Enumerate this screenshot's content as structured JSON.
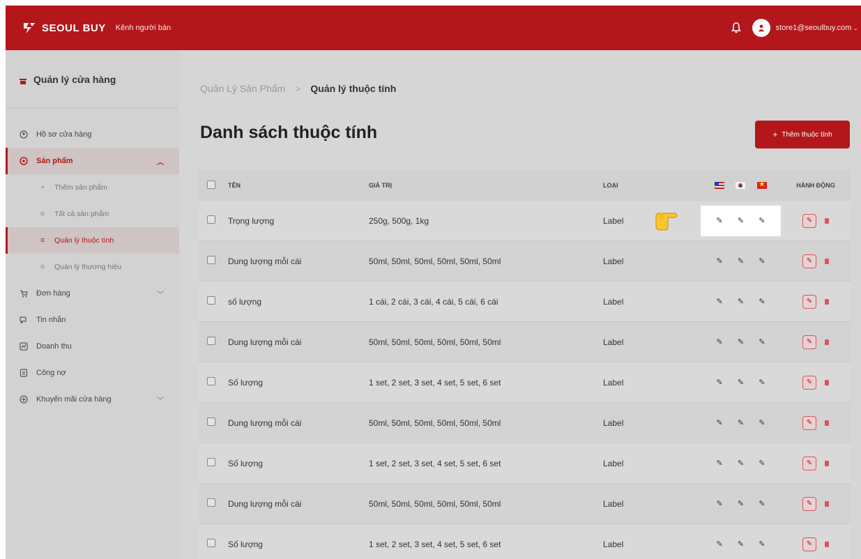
{
  "topbar": {
    "brand": "SEOUL BUY",
    "channel": "Kênh người bán",
    "user_email": "store1@seoulbuy.com",
    "colors": {
      "brand_red": "#b3171b"
    }
  },
  "sidebar": {
    "store_title": "Quản lý cửa hàng",
    "items": [
      {
        "label": "Hồ sơ cửa hàng",
        "icon": "store-profile-icon"
      },
      {
        "label": "Sản phẩm",
        "icon": "product-icon",
        "active": true,
        "expanded": true
      },
      {
        "label": "Đơn hàng",
        "icon": "cart-icon"
      },
      {
        "label": "Tin nhắn",
        "icon": "message-icon"
      },
      {
        "label": "Doanh thu",
        "icon": "revenue-icon"
      },
      {
        "label": "Công nợ",
        "icon": "debt-icon"
      },
      {
        "label": "Khuyến mãi cửa hàng",
        "icon": "promotion-icon"
      }
    ],
    "sub_items": [
      {
        "label": "Thêm sản phẩm",
        "icon": "plus-icon"
      },
      {
        "label": "Tất cả sản phẩm",
        "icon": "list-icon"
      },
      {
        "label": "Quản lý thuộc tính",
        "icon": "list-icon",
        "active": true
      },
      {
        "label": "Quản lý thương hiệu",
        "icon": "list-icon"
      }
    ]
  },
  "main": {
    "breadcrumb": {
      "parent": "Quản Lý Sản Phẩm",
      "separator": ">",
      "current": "Quản lý thuộc tính"
    },
    "title": "Danh sách thuộc tính",
    "add_button": "Thêm thuộc tính",
    "table": {
      "headers": {
        "name": "TÊN",
        "value": "GIÁ TRỊ",
        "type": "LOẠI",
        "actions": "HÀNH ĐỘNG"
      },
      "flags": [
        "us-flag-icon",
        "kr-flag-icon",
        "vn-flag-icon"
      ],
      "rows": [
        {
          "name": "Trọng lượng",
          "value": "250g, 500g, 1kg",
          "type": "Label"
        },
        {
          "name": "Dung lượng mỗi cái",
          "value": "50ml, 50ml, 50ml, 50ml, 50ml, 50ml",
          "type": "Label"
        },
        {
          "name": "số lượng",
          "value": "1 cái, 2 cái, 3 cái, 4 cái, 5 cái, 6 cái",
          "type": "Label"
        },
        {
          "name": "Dung lượng mỗi cái",
          "value": "50ml, 50ml, 50ml, 50ml, 50ml, 50ml",
          "type": "Label"
        },
        {
          "name": "Số lượng",
          "value": "1 set, 2 set, 3 set, 4 set, 5 set, 6 set",
          "type": "Label"
        },
        {
          "name": "Dung lượng mỗi cái",
          "value": "50ml, 50ml, 50ml, 50ml, 50ml, 50ml",
          "type": "Label"
        },
        {
          "name": "Số lượng",
          "value": "1 set, 2 set, 3 set, 4 set, 5 set, 6 set",
          "type": "Label"
        },
        {
          "name": "Dung lượng mỗi cái",
          "value": "50ml, 50ml, 50ml, 50ml, 50ml, 50ml",
          "type": "Label"
        },
        {
          "name": "Số lượng",
          "value": "1 set, 2 set, 3 set, 4 set, 5 set, 6 set",
          "type": "Label"
        }
      ]
    }
  }
}
